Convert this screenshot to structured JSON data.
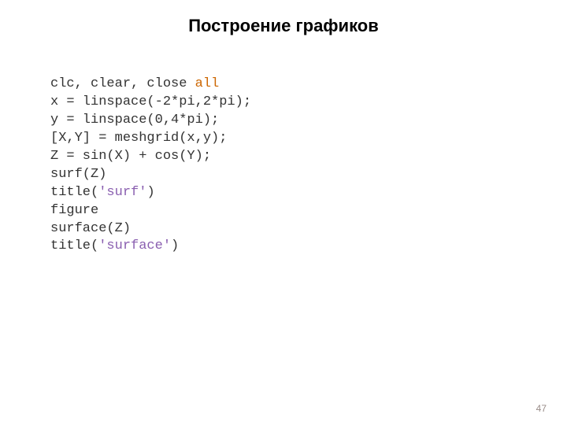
{
  "title": "Построение графиков",
  "code": {
    "l1a": "clc, clear, close ",
    "l1b": "all",
    "l2": "x = linspace(-2*pi,2*pi);",
    "l3": "y = linspace(0,4*pi);",
    "l4": "[X,Y] = meshgrid(x,y);",
    "l5": "Z = sin(X) + cos(Y);",
    "l6": "surf(Z)",
    "l7a": "title(",
    "l7b": "'surf'",
    "l7c": ")",
    "l8": "figure",
    "l9": "surface(Z)",
    "l10a": "title(",
    "l10b": "'surface'",
    "l10c": ")"
  },
  "page_number": "47"
}
